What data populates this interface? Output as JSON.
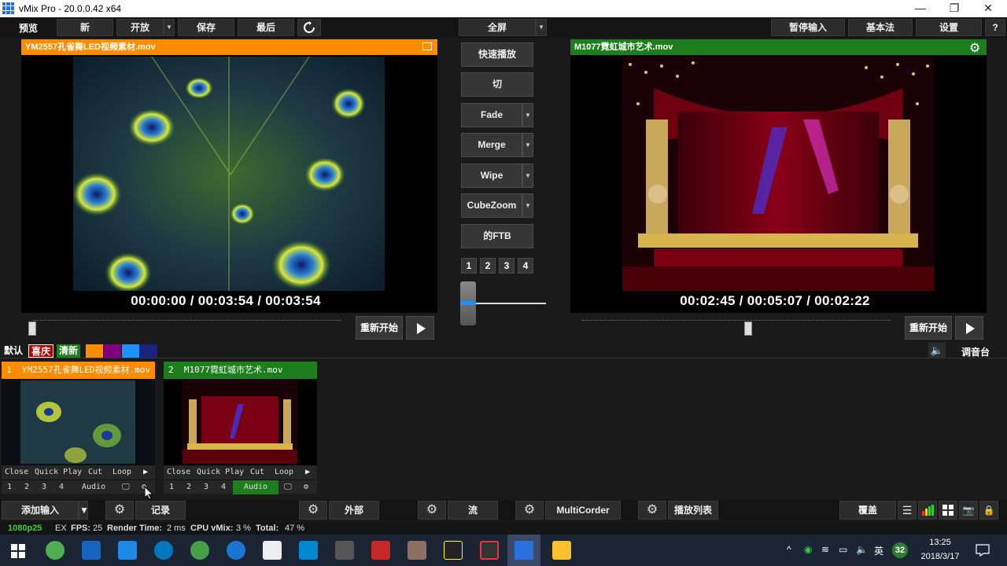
{
  "window": {
    "title": "vMix Pro - 20.0.0.42 x64",
    "minimize": "—",
    "maximize": "❐",
    "close": "✕"
  },
  "toolbar": {
    "preview": "预览",
    "new": "新",
    "open": "开放",
    "save": "保存",
    "last": "最后",
    "fullscreen": "全屏",
    "pause_input": "暂停输入",
    "basic": "基本法",
    "settings": "设置",
    "help": "?"
  },
  "preview": {
    "header": "YM2557孔雀舞LED视频素材.mov",
    "header_color": "#ff8c00",
    "time": "00:00:00  /  00:03:54  /  00:03:54",
    "restart": "重新开始",
    "position": 0.0
  },
  "output": {
    "header": "M1077霓虹城市艺术.mov",
    "header_color": "#1e7e1e",
    "time": "00:02:45  /  00:05:07  /  00:02:22",
    "restart": "重新开始",
    "position": 0.54
  },
  "transitions": {
    "quick_play": "快速播放",
    "cut": "切",
    "fade": "Fade",
    "merge": "Merge",
    "wipe": "Wipe",
    "cubezoom": "CubeZoom",
    "ftb": "的FTB",
    "nums": [
      "1",
      "2",
      "3",
      "4"
    ]
  },
  "tags": {
    "default": "默认",
    "xiqing": "喜庆",
    "qingxin": "清新",
    "colors": [
      "#ff8c00",
      "#800080",
      "#1e90ff",
      "#1a237e"
    ]
  },
  "mixer_label": "调音台",
  "inputs": [
    {
      "num": "1",
      "name": "YM2557孔雀舞LED视频素材.mov",
      "color": "#ff8c00",
      "close": "Close",
      "quick_play": "Quick Play",
      "cut": "Cut",
      "loop": "Loop",
      "audio": "Audio",
      "nums": [
        "1",
        "2",
        "3",
        "4"
      ]
    },
    {
      "num": "2",
      "name": "M1077霓虹城市艺术.mov",
      "color": "#1e7e1e",
      "close": "Close",
      "quick_play": "Quick Play",
      "cut": "Cut",
      "loop": "Loop",
      "audio": "Audio",
      "nums": [
        "1",
        "2",
        "3",
        "4"
      ]
    }
  ],
  "bottombar": {
    "add_input": "添加输入",
    "record": "记录",
    "external": "外部",
    "stream": "流",
    "multicorder": "MultiCorder",
    "playlist": "播放列表",
    "overlay": "覆盖"
  },
  "status": {
    "format": "1080p25",
    "ex": "EX",
    "fps_label": "FPS:",
    "fps": "25",
    "render_label": "Render Time:",
    "render": "2 ms",
    "cpu_label": "CPU vMix:",
    "cpu": "3 %",
    "total_label": "Total:",
    "total": "47 %"
  },
  "taskbar": {
    "time": "13:25",
    "date": "2018/3/17",
    "ime": "英",
    "badge": "32"
  }
}
